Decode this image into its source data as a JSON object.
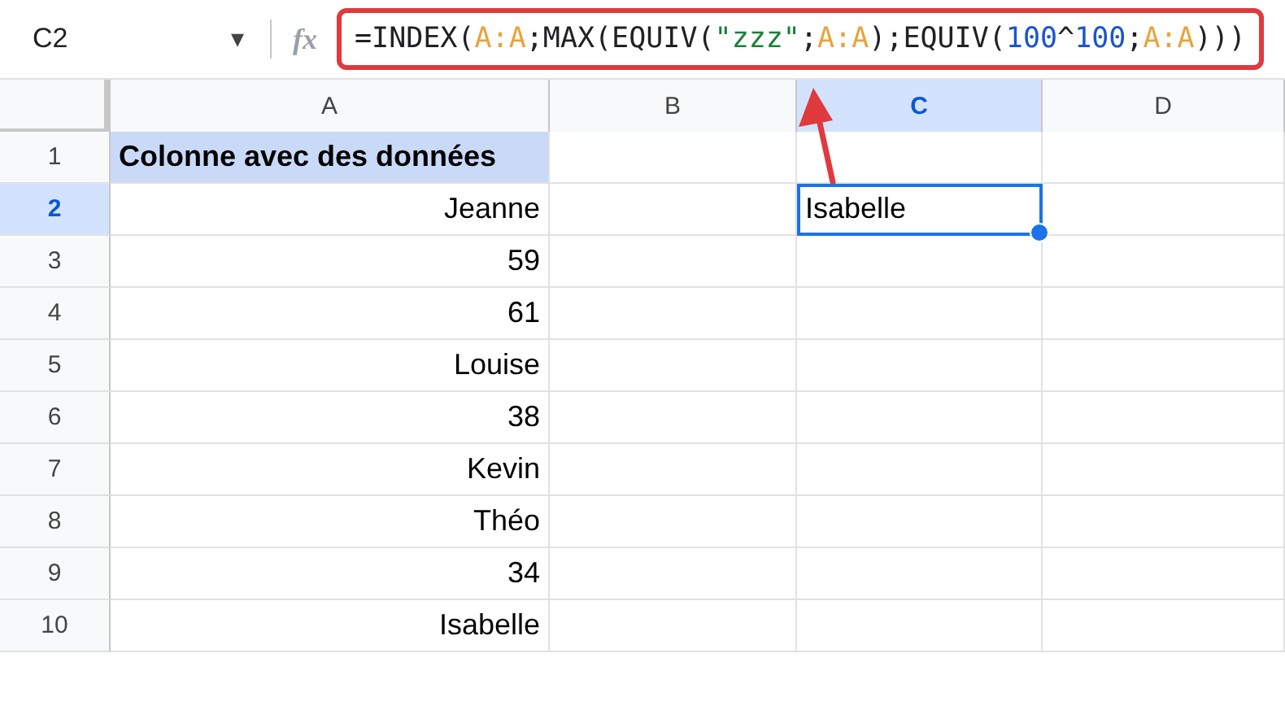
{
  "name_box": {
    "value": "C2",
    "caret": "▾"
  },
  "function_label": "fx",
  "formula": [
    {
      "kind": "plain",
      "text": "=INDEX("
    },
    {
      "kind": "range",
      "text": "A:A"
    },
    {
      "kind": "plain",
      "text": ";MAX(EQUIV("
    },
    {
      "kind": "string",
      "text": "\"zzz\""
    },
    {
      "kind": "plain",
      "text": ";"
    },
    {
      "kind": "range",
      "text": "A:A"
    },
    {
      "kind": "plain",
      "text": ");EQUIV("
    },
    {
      "kind": "number",
      "text": "100"
    },
    {
      "kind": "plain",
      "text": "^"
    },
    {
      "kind": "number",
      "text": "100"
    },
    {
      "kind": "plain",
      "text": ";"
    },
    {
      "kind": "range",
      "text": "A:A"
    },
    {
      "kind": "plain",
      "text": ")))"
    }
  ],
  "columns": [
    {
      "label": "A",
      "selected": false
    },
    {
      "label": "B",
      "selected": false
    },
    {
      "label": "C",
      "selected": true
    },
    {
      "label": "D",
      "selected": false
    }
  ],
  "rows": [
    {
      "number": "1",
      "selected": false,
      "a": {
        "text": "Colonne avec des données",
        "kind": "header"
      }
    },
    {
      "number": "2",
      "selected": true,
      "a": {
        "text": "Jeanne",
        "kind": "value"
      },
      "c": {
        "text": "Isabelle",
        "kind": "text",
        "active": true
      }
    },
    {
      "number": "3",
      "selected": false,
      "a": {
        "text": "59",
        "kind": "value"
      }
    },
    {
      "number": "4",
      "selected": false,
      "a": {
        "text": "61",
        "kind": "value"
      }
    },
    {
      "number": "5",
      "selected": false,
      "a": {
        "text": "Louise",
        "kind": "value"
      }
    },
    {
      "number": "6",
      "selected": false,
      "a": {
        "text": "38",
        "kind": "value"
      }
    },
    {
      "number": "7",
      "selected": false,
      "a": {
        "text": "Kevin",
        "kind": "value"
      }
    },
    {
      "number": "8",
      "selected": false,
      "a": {
        "text": "Théo",
        "kind": "value"
      }
    },
    {
      "number": "9",
      "selected": false,
      "a": {
        "text": "34",
        "kind": "value"
      }
    },
    {
      "number": "10",
      "selected": false,
      "a": {
        "text": "Isabelle",
        "kind": "value"
      }
    }
  ]
}
